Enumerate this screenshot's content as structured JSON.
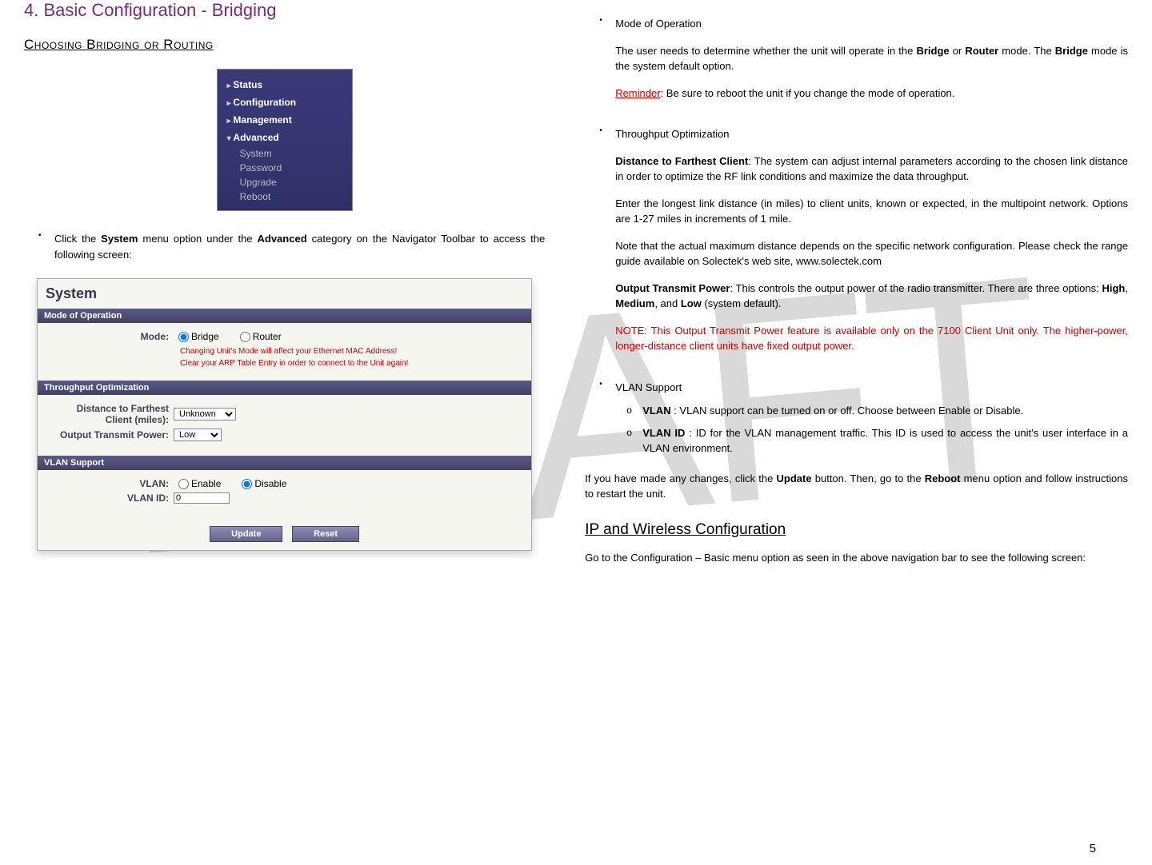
{
  "watermark": "DRAFT",
  "left": {
    "title": "4.  Basic Configuration - Bridging",
    "subtitle": "Choosing Bridging or Routing",
    "nav": {
      "status": "Status",
      "config": "Configuration",
      "mgmt": "Management",
      "adv": "Advanced",
      "system": "System",
      "password": "Password",
      "upgrade": "Upgrade",
      "reboot": "Reboot"
    },
    "click_text_a": "Click the ",
    "click_text_b": "System",
    "click_text_c": " menu option under the ",
    "click_text_d": "Advanced",
    "click_text_e": " category on the Navigator Toolbar to access the following screen:",
    "panel": {
      "title": "System",
      "bar1": "Mode of Operation",
      "mode_label": "Mode:",
      "mode_bridge": "Bridge",
      "mode_router": "Router",
      "warn1": "Changing Unit's Mode will affect your Ethernet MAC Address!",
      "warn2": "Clear your ARP Table Entry in order to connect to the Unit again!",
      "bar2": "Throughput Optimization",
      "dist_label1": "Distance to Farthest",
      "dist_label2": "Client (miles):",
      "dist_val": "Unknown",
      "otp_label": "Output Transmit Power:",
      "otp_val": "Low",
      "bar3": "VLAN Support",
      "vlan_label": "VLAN:",
      "vlan_enable": "Enable",
      "vlan_disable": "Disable",
      "vlanid_label": "VLAN ID:",
      "vlanid_val": "0",
      "btn_update": "Update",
      "btn_reset": "Reset"
    }
  },
  "right": {
    "mode_h": "Mode of Operation",
    "mode_p": "The user needs to determine whether the unit will operate in the <b>Bridge</b> or <b>Router</b> mode. The <b>Bridge</b> mode is the system default option.",
    "reminder_label": "Reminder",
    "reminder_text": ": Be sure to reboot the unit if you change the mode of operation.",
    "th_h": "Throughput Optimization",
    "th_p1": "<b>Distance to Farthest Client</b>: The system can adjust internal parameters according to the chosen link distance in order to optimize the RF link conditions and maximize the data throughput.",
    "th_p2": "Enter the longest link distance (in miles) to client units, known or expected, in the multipoint network. Options are 1-27 miles in increments of 1 mile.",
    "th_p3": "Note that the actual maximum distance depends on the specific network configuration. Please check the range guide available on Solectek's web site, www.solectek.com",
    "th_p4": "<b>Output Transmit Power</b>: This controls the output power of the radio transmitter. There are three options: <b>High</b>, <b>Medium</b>, and <b>Low</b> (system default).",
    "th_note": "NOTE: This Output Transmit Power feature is available only on the 7100 Client Unit only. The higher-power, longer-distance client units have fixed output power.",
    "vlan_h": "VLAN Support",
    "vlan_a": "<b>VLAN</b> : VLAN support can be turned on or off. Choose between Enable or Disable.",
    "vlan_b": "<b>VLAN ID</b> : ID for the VLAN management traffic. This ID is used to access the unit's user interface in a VLAN environment.",
    "after": "If you have made any changes, click the <b>Update</b> button. Then, go to the <b>Reboot</b> menu option and follow instructions to restart the unit.",
    "ip_h": "IP and Wireless Configuration",
    "ip_p": "Go to the Configuration – Basic menu option as seen in the above navigation bar to see the following screen:"
  },
  "page_num": "5"
}
